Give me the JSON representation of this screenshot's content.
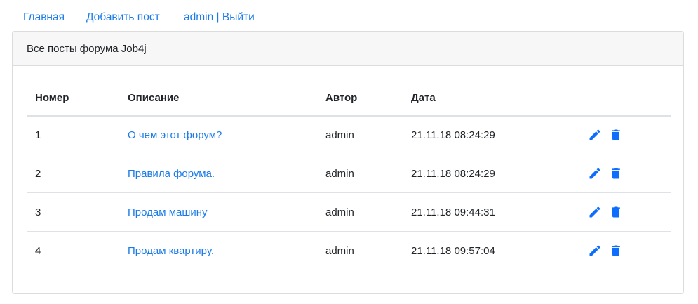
{
  "nav": {
    "home": "Главная",
    "add_post": "Добавить пост",
    "user_logout": "admin | Выйти"
  },
  "card": {
    "header": "Все посты форума Job4j"
  },
  "table": {
    "columns": [
      "Номер",
      "Описание",
      "Автор",
      "Дата",
      ""
    ],
    "rows": [
      {
        "number": "1",
        "description": "О чем этот форум?",
        "author": "admin",
        "date": "21.11.18 08:24:29"
      },
      {
        "number": "2",
        "description": "Правила форума.",
        "author": "admin",
        "date": "21.11.18 08:24:29"
      },
      {
        "number": "3",
        "description": "Продам машину",
        "author": "admin",
        "date": "21.11.18 09:44:31"
      },
      {
        "number": "4",
        "description": "Продам квартиру.",
        "author": "admin",
        "date": "21.11.18 09:57:04"
      }
    ]
  },
  "icons": {
    "edit": "pencil-icon",
    "delete": "trash-icon"
  },
  "colors": {
    "link": "#1a7be8",
    "icon": "#0d6efd",
    "header_bg": "#f7f7f7"
  }
}
